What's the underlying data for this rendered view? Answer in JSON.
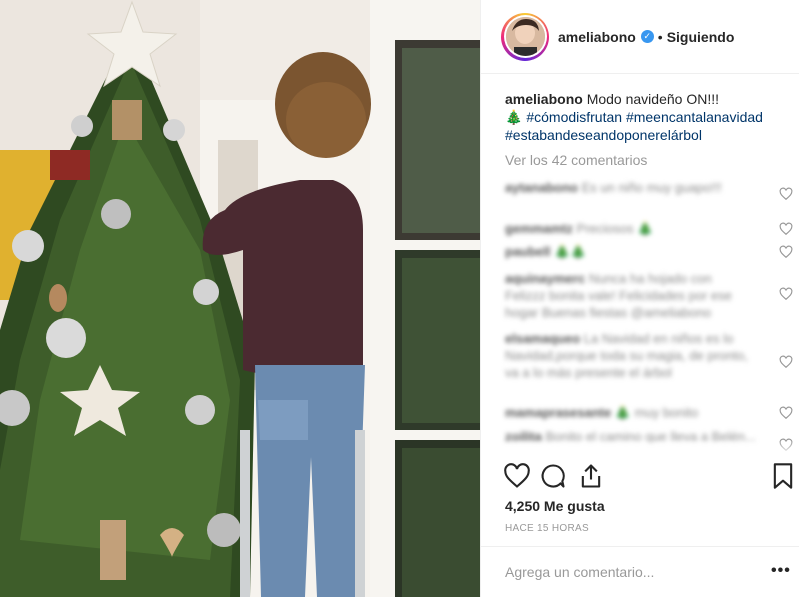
{
  "post": {
    "username": "ameliabono",
    "verified_icon": "verified-badge-icon",
    "separator": "•",
    "follow_label": "Siguiendo",
    "caption_text": "Modo navideño ON!!!",
    "caption_emoji": "🎄",
    "hashtags_line1": "#cómodisfrutan",
    "hashtags_line1b": "#meencantalanavidad",
    "hashtags_line2": "#estabandeseandoponerelárbol",
    "view_comments": "Ver los 42 comentarios",
    "likes": "4,250 Me gusta",
    "time": "HACE 15 HORAS",
    "add_comment_placeholder": "Agrega un comentario...",
    "more_label": "•••"
  },
  "comments": [
    {
      "user": "aytanabono",
      "text": "Es un niño muy guapo!!!"
    },
    {
      "user": "gemmamtz",
      "text": "Preciosos 🎄"
    },
    {
      "user": "paubell",
      "text": "🎄🎄"
    },
    {
      "user": "aquinaymerc",
      "text": "Nunca ha hojado con Felizzz bonita vale! Felicidades por ese hogar Buenas fiestas @ameliabono"
    },
    {
      "user": "elsamaqueo",
      "text": "La Navidad en niños es lo Navidad,porque toda su magia, de pronto, va a lo más presente el árbol"
    },
    {
      "user": "mamaprasesante",
      "text": "🎄 muy bonito"
    },
    {
      "user": "zoilita",
      "text": "Bonito el camino que lleva a Belén..."
    }
  ],
  "colors": {
    "link": "#003569",
    "muted": "#999999",
    "text": "#262626",
    "verified": "#3897f0"
  }
}
